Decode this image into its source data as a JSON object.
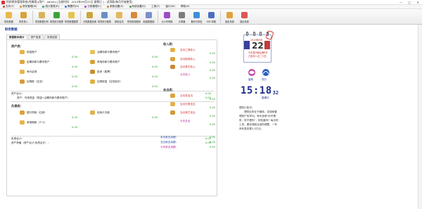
{
  "window": {
    "title": "阿邦财务管理系统(完美版)(用户：admin) [当前时间：2019年09月22日 星期日 ] - 试用版(每月开放使用)"
  },
  "menu": [
    "文件(F)",
    "财务管理(M)",
    "统计报表(R)",
    "需要时(H)",
    "分类管理(C)",
    "参数设置(S)",
    "系统设置(X)",
    "工具(T)",
    "窗口(W)",
    "帮助(H)"
  ],
  "toolbar": [
    "财务数据",
    "财务录入",
    "财务数据分析",
    "财务统计图表",
    "财务数据图表",
    "分类数据设置",
    "财务统计图表",
    "新增会员",
    "财务核准模块",
    "新建数据源",
    "大小写转换",
    "计算器",
    "备份与恢复",
    "MIS 帮助",
    "锁定系统",
    "退出系统"
  ],
  "panel": {
    "title": "财务数据",
    "tabs": [
      "家庭账本统计",
      "资产信息",
      "负债信息"
    ]
  },
  "assets": {
    "heading": "资产类：",
    "items": [
      {
        "label": "现金账户",
        "value": "0.00"
      },
      {
        "label": "活期存款与基本账户",
        "value": "0.00"
      },
      {
        "label": "定期存款与基本账户",
        "value": "0.00"
      },
      {
        "label": "其他存款与基本账户",
        "value": "0.00"
      },
      {
        "label": "有价证券",
        "value": "0.00"
      },
      {
        "label": "投资（股票）",
        "value": "0.00"
      },
      {
        "label": "实物账（住宅）",
        "value": "0.00"
      },
      {
        "label": "实物财富（住宅除外）",
        "value": "0.00"
      }
    ],
    "total_label": "资产合计：",
    "total_value": "0.00",
    "net_label": "资产：可用资金（现金+活期存款与基本账户）",
    "net_value": "0.00"
  },
  "liabilities": {
    "heading": "负债类：",
    "items": [
      {
        "label": "银行贷款（住房）",
        "value": "0.00"
      },
      {
        "label": "信用卡欠款",
        "value": "0.00"
      },
      {
        "label": "其他借款（个人）",
        "value": "0.00"
      }
    ],
    "total_label": "负债合计：",
    "total_value": "0.00",
    "networth_label": "资产净值（资产合计-负债合计）：",
    "networth_value": "0.00"
  },
  "income": {
    "heading": "收入类：",
    "items": [
      {
        "label": "当月工资收入",
        "value": "0.00"
      },
      {
        "label": "当月投资收入",
        "value": "0.00"
      },
      {
        "label": "当月其它收入",
        "value": "0.00"
      },
      {
        "label": "今天收入",
        "value": "0.00"
      }
    ]
  },
  "expense": {
    "heading": "支出类：",
    "items": [
      {
        "label": "当月总支出",
        "value": "0.00"
      },
      {
        "label": "当月日常支出",
        "value": "0.00"
      },
      {
        "label": "当月其它支出",
        "value": "0.00"
      },
      {
        "label": "今天支出",
        "value": "0.00"
      }
    ],
    "summary": [
      {
        "label": "本月收支余额：",
        "value": "0.00"
      },
      {
        "label": "当日收支余额：",
        "value": "0.00"
      },
      {
        "label": "今天收支余额：",
        "value": "0.00"
      }
    ]
  },
  "calendar": {
    "year_month": "2019年9月",
    "day": "22",
    "line1": "今天是中秋后第8天",
    "line2": "己亥年八月二十四"
  },
  "icons_small": [
    "星期",
    "农历"
  ],
  "clock": {
    "hm": "15:18",
    "sec": "32",
    "weekday": "星期日"
  },
  "tips": {
    "title": "理财小知识：",
    "body": "理财目的在于赚钱、花钱和管理财产的学问。有句谚语\"你不理财，财不理你\"，你知道吗？每月的工资，要存储到合适的储蓄，一年来利息将是2.5万元。"
  }
}
